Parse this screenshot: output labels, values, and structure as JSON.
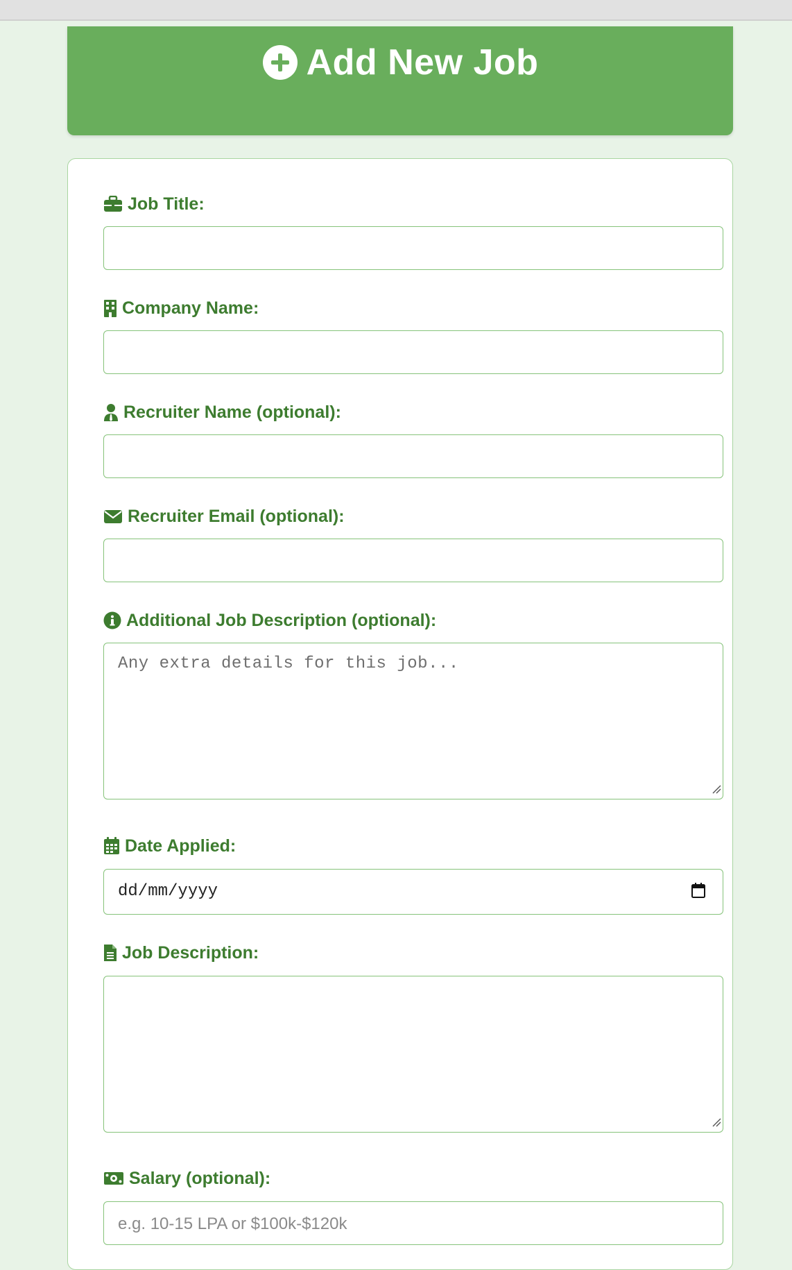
{
  "header": {
    "title": "Add New Job",
    "icon": "plus-circle-icon"
  },
  "colors": {
    "accent": "#69ae5c",
    "label": "#3d7c2f",
    "border": "#86c37a",
    "background": "#e8f3e7"
  },
  "form": {
    "job_title": {
      "label": "Job Title:",
      "icon": "briefcase-icon",
      "value": ""
    },
    "company_name": {
      "label": "Company Name:",
      "icon": "building-icon",
      "value": ""
    },
    "recruiter_name": {
      "label": "Recruiter Name (optional):",
      "icon": "user-tie-icon",
      "value": ""
    },
    "recruiter_email": {
      "label": "Recruiter Email (optional):",
      "icon": "envelope-icon",
      "value": ""
    },
    "additional_description": {
      "label": "Additional Job Description (optional):",
      "icon": "info-circle-icon",
      "placeholder": "Any extra details for this job...",
      "value": ""
    },
    "date_applied": {
      "label": "Date Applied:",
      "icon": "calendar-icon",
      "value": "dd/mm/yyyy"
    },
    "job_description": {
      "label": "Job Description:",
      "icon": "document-icon",
      "value": ""
    },
    "salary": {
      "label": "Salary (optional):",
      "icon": "money-bill-icon",
      "placeholder": "e.g. 10-15 LPA or $100k-$120k",
      "value": ""
    }
  }
}
